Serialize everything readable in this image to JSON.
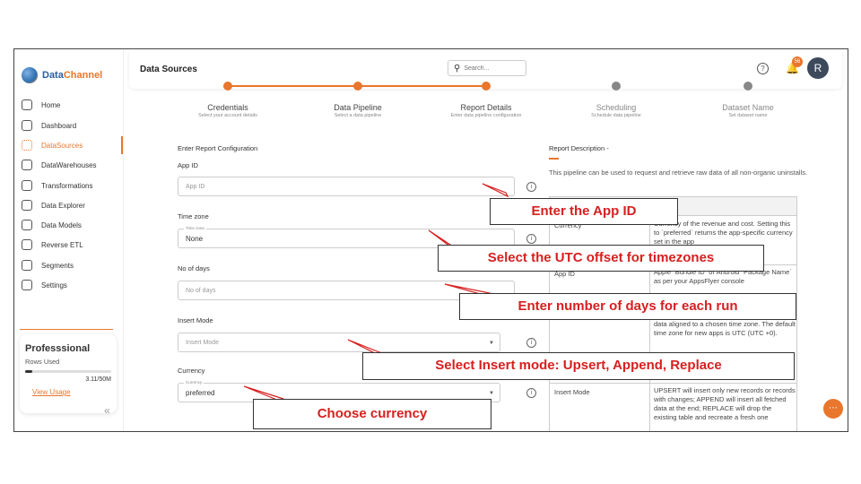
{
  "brand": {
    "name_part1": "Data",
    "name_part2": "Channel"
  },
  "header": {
    "title": "Data Sources",
    "search_placeholder": "Search...",
    "help_glyph": "?",
    "notif_count": "56",
    "avatar_letter": "R"
  },
  "sidebar": {
    "items": [
      {
        "label": "Home"
      },
      {
        "label": "Dashboard"
      },
      {
        "label": "DataSources"
      },
      {
        "label": "DataWarehouses"
      },
      {
        "label": "Transformations"
      },
      {
        "label": "Data Explorer"
      },
      {
        "label": "Data Models"
      },
      {
        "label": "Reverse ETL"
      },
      {
        "label": "Segments"
      },
      {
        "label": "Settings"
      }
    ],
    "plan": {
      "title": "Professsional",
      "rows_label": "Rows Used",
      "usage": "3.11/50M",
      "usage_fraction": 0.08,
      "link": "View Usage"
    },
    "collapse_glyph": "«"
  },
  "stepper": [
    {
      "title": "Credentials",
      "sub": "Select your account details",
      "state": "done"
    },
    {
      "title": "Data Pipeline",
      "sub": "Select a data pipeline",
      "state": "done"
    },
    {
      "title": "Report Details",
      "sub": "Enter data pipeline configuration",
      "state": "done"
    },
    {
      "title": "Scheduling",
      "sub": "Schedule data pipeline",
      "state": "todo"
    },
    {
      "title": "Dataset Name",
      "sub": "Set dataset name",
      "state": "todo"
    }
  ],
  "form": {
    "section_title": "Enter Report Configuration",
    "app_id": {
      "label": "App ID",
      "placeholder": "App ID"
    },
    "timezone": {
      "label": "Time zone",
      "floating": "Time zone",
      "value": "None"
    },
    "days": {
      "label": "No of days",
      "placeholder": "No of days"
    },
    "insert_mode": {
      "label": "Insert Mode",
      "placeholder": "Insert Mode"
    },
    "currency": {
      "label": "Currency",
      "floating": "Currency",
      "value": "preferred"
    },
    "info_glyph": "i"
  },
  "report": {
    "title": "Report Description -",
    "text": "This pipeline can be used to request and retrieve raw data of all non-organic uninstalls.",
    "col_header": "ription",
    "rows": [
      {
        "name": "Currency",
        "desc": "Currency of the revenue and cost. Setting this to `preferred` returns the app-specific currency set in the app"
      },
      {
        "name": "App ID",
        "desc": "Apple `Bundle ID` or Android `Package Name` as per your AppsFlyer console"
      },
      {
        "name": "",
        "desc": "data aligned to a chosen time zone. The default time zone for new apps is UTC (UTC +0)."
      },
      {
        "name": "Insert Mode",
        "desc": "UPSERT will insert only new records or records with changes; APPEND will insert all fetched data at the end; REPLACE will drop the existing table and recreate a fresh one"
      }
    ],
    "row3_tail": "h"
  },
  "annotations": {
    "app_id": "Enter the App ID",
    "timezone": "Select the UTC offset for timezones",
    "days": "Enter number of days for each run",
    "insert": "Select Insert mode: Upsert, Append, Replace",
    "currency": "Choose currency"
  }
}
